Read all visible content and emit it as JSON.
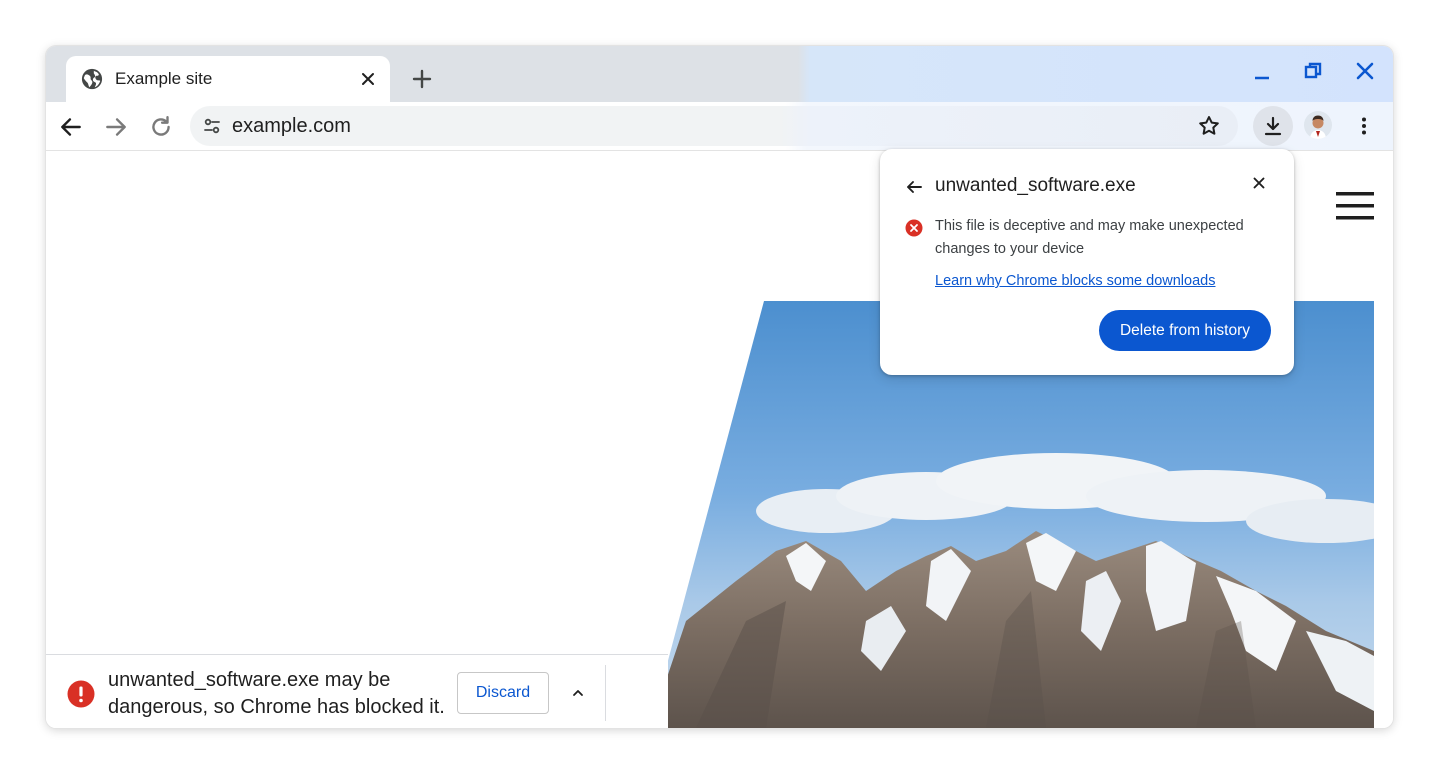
{
  "tab": {
    "title": "Example site"
  },
  "omnibox": {
    "url": "example.com"
  },
  "download_bubble": {
    "filename": "unwanted_software.exe",
    "message": "This file is deceptive and may make unexpected changes to your device",
    "learn_link": "Learn why Chrome blocks some downloads",
    "delete_button": "Delete from history"
  },
  "download_shelf": {
    "message": "unwanted_software.exe may be dangerous, so Chrome has blocked it.",
    "discard_button": "Discard"
  },
  "colors": {
    "accent": "#0b57d0",
    "error": "#d93025",
    "tabstrip_grey": "#dde1e6",
    "tabstrip_blue": "#d3e3fd"
  },
  "icons": {
    "favicon": "globe-icon",
    "tab_close": "close-icon",
    "new_tab": "plus-icon",
    "minimize": "minimize-icon",
    "restore": "restore-icon",
    "close_window": "close-icon",
    "back": "arrow-left-icon",
    "forward": "arrow-right-icon",
    "reload": "reload-icon",
    "site_info": "tune-icon",
    "bookmark": "star-icon",
    "downloads": "download-icon",
    "profile": "avatar",
    "menu": "kebab-menu-icon",
    "page_menu": "hamburger-icon",
    "error": "error-icon",
    "expand": "chevron-up-icon"
  }
}
